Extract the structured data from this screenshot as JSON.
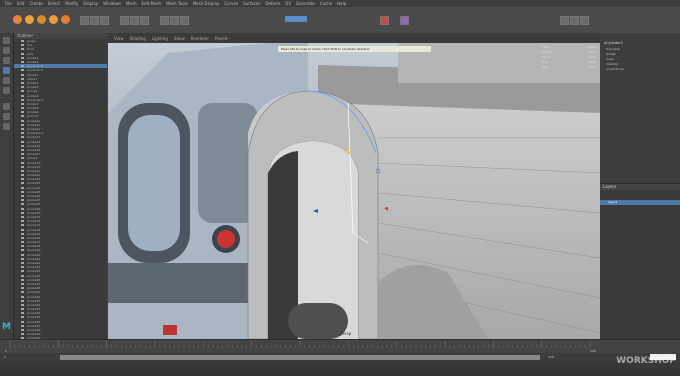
{
  "app": {
    "title": "Autodesk Maya"
  },
  "menubar": {
    "items": [
      "File",
      "Edit",
      "Create",
      "Select",
      "Modify",
      "Display",
      "Windows",
      "Mesh",
      "Edit Mesh",
      "Mesh Tools",
      "Mesh Display",
      "Curves",
      "Surfaces",
      "Deform",
      "UV",
      "Generate",
      "Cache",
      "Help"
    ]
  },
  "viewport": {
    "tabs": [
      "View",
      "Shading",
      "Lighting",
      "Show",
      "Renderer",
      "Panels"
    ],
    "message": "Press Ctrl to snap to mesh. Hold Shift to constrain direction",
    "camera_label": "persp"
  },
  "heads_up": {
    "rows": [
      {
        "label": "Verts:",
        "value": "1304"
      },
      {
        "label": "Edges:",
        "value": "2571"
      },
      {
        "label": "Faces:",
        "value": "1270"
      },
      {
        "label": "Tris:",
        "value": "2540"
      },
      {
        "label": "UVs:",
        "value": "1378"
      }
    ]
  },
  "channel_box": {
    "title": "pCylinder1",
    "items": [
      "Translate",
      "Rotate",
      "Scale",
      "Visibility",
      "polyExtrude"
    ]
  },
  "layers": {
    "label": "Layers",
    "row_label": "layer1"
  },
  "outliner": {
    "header": "Outliner",
    "items": [
      "persp",
      "top",
      "front",
      "side",
      "pCube1",
      "pCube2",
      "pCylinder1",
      "pCylinder2",
      "pCube3",
      "pPipe1",
      "pCube4",
      "pCube5",
      "group1",
      "pCube6",
      "pCylinder3",
      "pCube7",
      "pCube8",
      "pCube9",
      "pTorus1",
      "pCube10",
      "pCube11",
      "pCube12",
      "pCylinder4",
      "pCube13",
      "pCube14",
      "pCube15",
      "pCube16",
      "pCube17",
      "group2",
      "pCube18",
      "pCube19",
      "pCube20",
      "pCube21",
      "pCube22",
      "pCube23",
      "pCube24",
      "pCube25",
      "pCube26",
      "pCube27",
      "pCube28",
      "pCube29",
      "pCube30",
      "pCube31",
      "pCube32",
      "pCube33",
      "pCube34",
      "pCube35",
      "pCube36",
      "pCube37",
      "pCube38",
      "pCube39",
      "pCube40",
      "pCube41",
      "pCube42",
      "pCube43",
      "pCube44",
      "pCube45",
      "pCube46",
      "pCube47",
      "pCube48",
      "pCube49",
      "pCube50",
      "pCube51",
      "pCube52",
      "pCube53",
      "pCube54",
      "pCube55",
      "pCube56",
      "pCube57",
      "pCube58",
      "pCube59",
      "pCube60"
    ],
    "selected_index": 6
  },
  "timeline": {
    "start": "1",
    "end": "120"
  },
  "range": {
    "start": "1",
    "end": "120"
  },
  "watermark": "WORKSHOP",
  "colors": {
    "accent_select": "#4d7aa8",
    "ui_dark": "#3a3a3a",
    "viewport_bg": "#a7b2bf"
  }
}
